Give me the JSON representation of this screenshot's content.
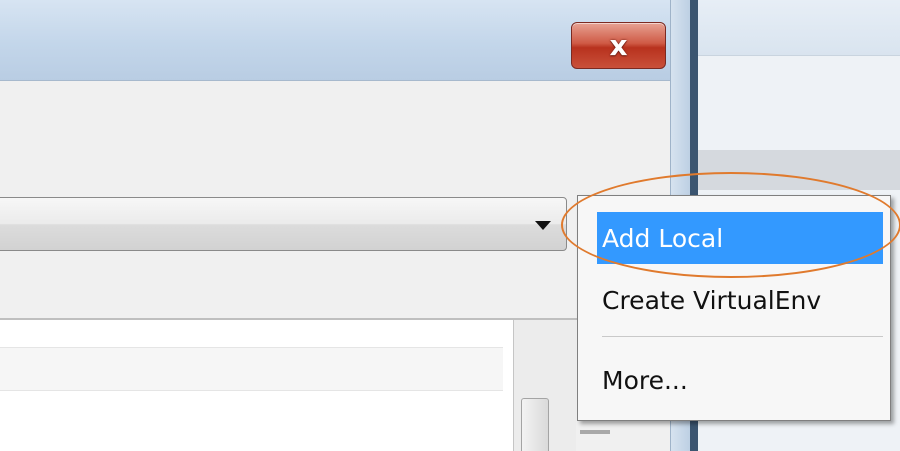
{
  "dialog": {
    "close_label": "x",
    "close_icon": "close-icon"
  },
  "combo": {
    "arrow_icon": "dropdown-arrow-icon"
  },
  "menu": {
    "items": [
      {
        "label": "Add Local",
        "selected": true
      },
      {
        "label": "Create VirtualEnv",
        "selected": false
      },
      {
        "label": "More...",
        "selected": false
      }
    ]
  },
  "colors": {
    "selection": "#3399ff",
    "highlight_ring": "#e07a2d",
    "close_button": "#c9503a"
  }
}
